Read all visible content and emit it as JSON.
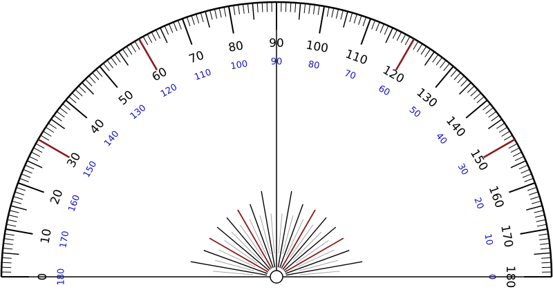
{
  "protractor": {
    "outer_scale": [
      "0",
      "10",
      "20",
      "30",
      "40",
      "50",
      "60",
      "70",
      "80",
      "90",
      "100",
      "110",
      "120",
      "130",
      "140",
      "150",
      "160",
      "170",
      "180"
    ],
    "inner_scale": [
      "180",
      "170",
      "160",
      "150",
      "140",
      "130",
      "120",
      "110",
      "100",
      "90",
      "80",
      "70",
      "60",
      "50",
      "40",
      "30",
      "20",
      "10",
      "0"
    ],
    "colors": {
      "outline": "#000000",
      "outer_labels": "#000000",
      "inner_labels": "#1010c8",
      "highlight_ticks": "#8b1a1a",
      "minor_rays": "#9a9a9a",
      "background": "#ffffff"
    }
  }
}
